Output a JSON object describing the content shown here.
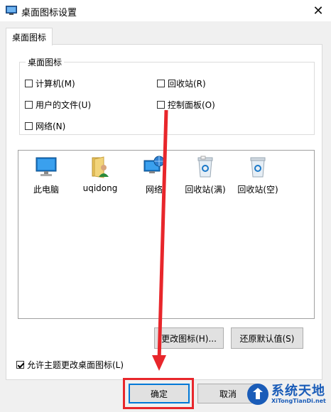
{
  "window": {
    "title": "桌面图标设置",
    "close_glyph": "✕"
  },
  "tab": {
    "label": "桌面图标"
  },
  "group": {
    "label": "桌面图标",
    "checkboxes": [
      {
        "label": "计算机(M)",
        "checked": false
      },
      {
        "label": "回收站(R)",
        "checked": false
      },
      {
        "label": "用户的文件(U)",
        "checked": false
      },
      {
        "label": "控制面板(O)",
        "checked": false
      },
      {
        "label": "网络(N)",
        "checked": false
      }
    ]
  },
  "icons": [
    {
      "label": "此电脑",
      "icon": "computer-icon"
    },
    {
      "label": "uqidong",
      "icon": "user-folder-icon"
    },
    {
      "label": "网络",
      "icon": "network-icon"
    },
    {
      "label": "回收站(满)",
      "icon": "recycle-bin-full-icon"
    },
    {
      "label": "回收站(空)",
      "icon": "recycle-bin-empty-icon"
    }
  ],
  "buttons": {
    "change_icon": "更改图标(H)...",
    "restore_default": "还原默认值(S)",
    "ok": "确定",
    "cancel": "取消"
  },
  "allow_theme": {
    "label": "允许主题更改桌面图标(L)",
    "checked": true
  },
  "watermark": {
    "brand": "系统天地",
    "url": "XiTongTianDi.net"
  },
  "colors": {
    "annotation_red": "#e8262b",
    "accent": "#0078d7"
  }
}
